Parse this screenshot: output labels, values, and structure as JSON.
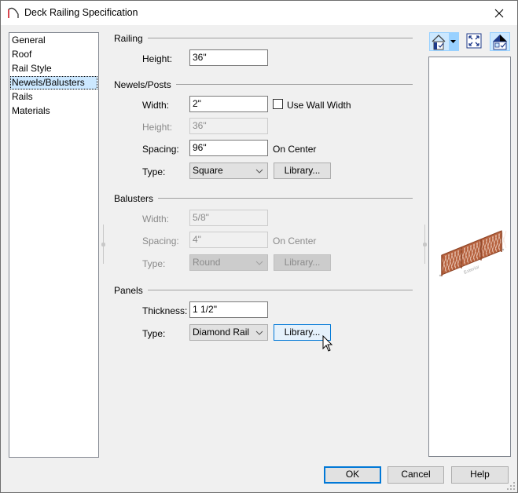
{
  "window": {
    "title": "Deck Railing Specification",
    "icon": "arch-icon",
    "close_icon": "close-icon"
  },
  "nav": {
    "items": [
      {
        "label": "General",
        "selected": false
      },
      {
        "label": "Roof",
        "selected": false
      },
      {
        "label": "Rail Style",
        "selected": false
      },
      {
        "label": "Newels/Balusters",
        "selected": true
      },
      {
        "label": "Rails",
        "selected": false
      },
      {
        "label": "Materials",
        "selected": false
      }
    ]
  },
  "railing": {
    "title": "Railing",
    "height_label": "Height:",
    "height_value": "36\""
  },
  "newels": {
    "title": "Newels/Posts",
    "width_label": "Width:",
    "width_value": "2\"",
    "use_wall_width_label": "Use Wall Width",
    "use_wall_width_checked": false,
    "height_label": "Height:",
    "height_value": "36\"",
    "spacing_label": "Spacing:",
    "spacing_value": "96\"",
    "spacing_suffix": "On Center",
    "type_label": "Type:",
    "type_value": "Square",
    "library_label": "Library..."
  },
  "balusters": {
    "title": "Balusters",
    "width_label": "Width:",
    "width_value": "5/8\"",
    "spacing_label": "Spacing:",
    "spacing_value": "4\"",
    "spacing_suffix": "On Center",
    "type_label": "Type:",
    "type_value": "Round",
    "library_label": "Library..."
  },
  "panels": {
    "title": "Panels",
    "thickness_label": "Thickness:",
    "thickness_value": "1 1/2\"",
    "type_label": "Type:",
    "type_value": "Diamond Rail",
    "library_label": "Library..."
  },
  "preview": {
    "toolbar": [
      "view-mode-icon",
      "fit-to-window-icon",
      "render-preview-icon"
    ],
    "caption": "Exterior",
    "colors": {
      "panel": "#b5603c",
      "panel_dark": "#8e4426"
    }
  },
  "footer": {
    "ok_label": "OK",
    "cancel_label": "Cancel",
    "help_label": "Help"
  }
}
